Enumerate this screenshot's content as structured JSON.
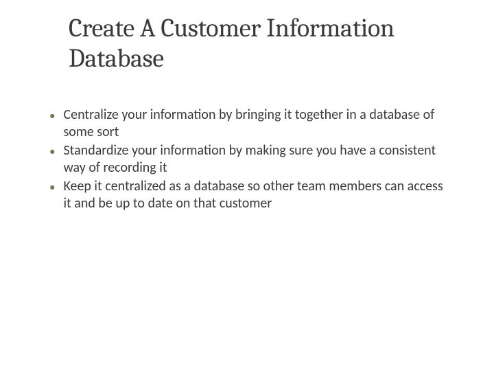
{
  "slide": {
    "title": "Create A Customer Information Database",
    "bullets": [
      "Centralize your information by bringing it together in a database of some sort",
      "Standardize your information by making sure you have a consistent way of recording it",
      "Keep it centralized as a database so other team members can access it and be up to date on that customer"
    ],
    "bullet_marker": "•"
  },
  "colors": {
    "text": "#3a3a3a",
    "bullet": "#7a7455",
    "background": "#ffffff"
  }
}
